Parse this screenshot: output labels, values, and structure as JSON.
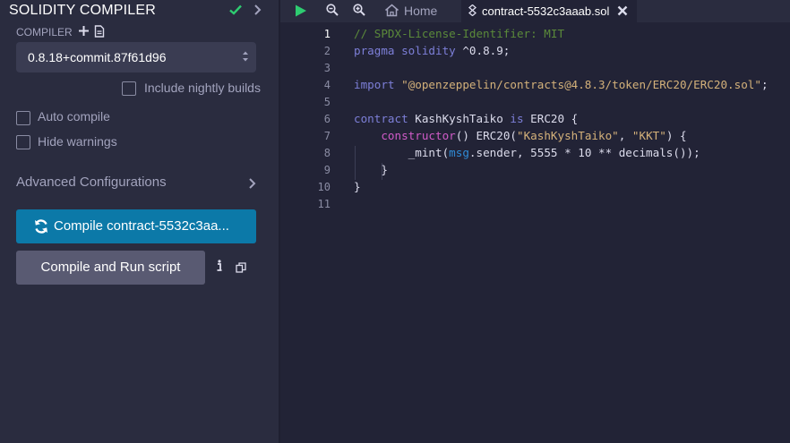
{
  "sidebar": {
    "title": "SOLIDITY COMPILER",
    "compiler_label": "COMPILER",
    "compiler_version": "0.8.18+commit.87f61d96",
    "include_nightly_label": "Include nightly builds",
    "auto_compile_label": "Auto compile",
    "hide_warnings_label": "Hide warnings",
    "advanced_label": "Advanced Configurations",
    "compile_button_label": "Compile contract-5532c3aa...",
    "run_script_button_label": "Compile and Run script"
  },
  "editor": {
    "home_tab_label": "Home",
    "active_tab_label": "contract-5532c3aaab.sol",
    "line_numbers": [
      "1",
      "2",
      "3",
      "4",
      "5",
      "6",
      "7",
      "8",
      "9",
      "10",
      "11"
    ],
    "code": {
      "l1": "// SPDX-License-Identifier: MIT",
      "l2_kw": "pragma solidity",
      "l2_rest": " ^0.8.9;",
      "l4_kw": "import",
      "l4_str": "\"@openzeppelin/contracts@4.8.3/token/ERC20/ERC20.sol\"",
      "l4_end": ";",
      "l6_kw": "contract",
      "l6_name": " KashKyshTaiko ",
      "l6_is": "is",
      "l6_rest": " ERC20 {",
      "l7_fn": "constructor",
      "l7_mid": "() ERC20(",
      "l7_s1": "\"KashKyshTaiko\"",
      "l7_comma": ", ",
      "l7_s2": "\"KKT\"",
      "l7_end": ") {",
      "l8_a": "_mint(",
      "l8_msg": "msg",
      "l8_rest": ".sender, 5555 * 10 ** decimals());",
      "l9": "}",
      "l10": "}"
    }
  },
  "colors": {
    "panel_bg": "#2a2c3f",
    "editor_bg": "#222336",
    "compile_button": "#0c79a8",
    "run_button": "#595a72",
    "check_green": "#2ecc71"
  }
}
